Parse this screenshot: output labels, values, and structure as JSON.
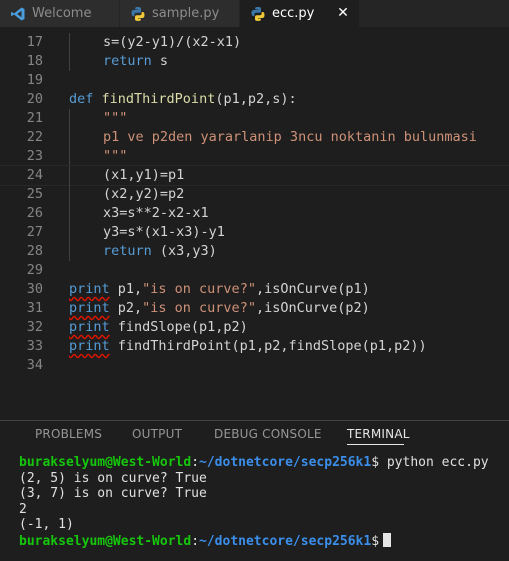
{
  "tabs": [
    {
      "label": "Welcome",
      "icon": "vscode-icon",
      "active": false
    },
    {
      "label": "sample.py",
      "icon": "python-icon",
      "active": false
    },
    {
      "label": "ecc.py",
      "icon": "python-icon",
      "active": true,
      "close": "✕"
    }
  ],
  "editor": {
    "lines": [
      {
        "n": "17",
        "parts": [
          {
            "c": "id",
            "t": "s=(y2-y1)/(x2-x1)"
          }
        ]
      },
      {
        "n": "18",
        "parts": [
          {
            "c": "kw",
            "t": "return"
          },
          {
            "c": "id",
            "t": " s"
          }
        ]
      },
      {
        "n": "19",
        "parts": []
      },
      {
        "n": "20",
        "parts": [
          {
            "c": "kw",
            "t": "def"
          },
          {
            "c": "id",
            "t": " "
          },
          {
            "c": "fn",
            "t": "findThirdPoint"
          },
          {
            "c": "id",
            "t": "(p1,p2,s):"
          }
        ]
      },
      {
        "n": "21",
        "parts": [
          {
            "c": "str",
            "t": "\"\"\""
          }
        ]
      },
      {
        "n": "22",
        "parts": [
          {
            "c": "str",
            "t": "p1 ve p2den yararlanip 3ncu noktanin bulunmasi"
          }
        ]
      },
      {
        "n": "23",
        "parts": [
          {
            "c": "str",
            "t": "\"\"\""
          }
        ]
      },
      {
        "n": "24",
        "parts": [
          {
            "c": "id",
            "t": "(x1,y1)=p1"
          }
        ]
      },
      {
        "n": "25",
        "parts": [
          {
            "c": "id",
            "t": "(x2,y2)=p2"
          }
        ]
      },
      {
        "n": "26",
        "parts": [
          {
            "c": "id",
            "t": "x3=s**2-x2-x1"
          }
        ]
      },
      {
        "n": "27",
        "parts": [
          {
            "c": "id",
            "t": "y3=s*(x1-x3)-y1"
          }
        ]
      },
      {
        "n": "28",
        "parts": [
          {
            "c": "kw",
            "t": "return"
          },
          {
            "c": "id",
            "t": " (x3,y3)"
          }
        ]
      },
      {
        "n": "29",
        "parts": []
      },
      {
        "n": "30",
        "parts": [
          {
            "c": "kw sq",
            "t": "print"
          },
          {
            "c": "id",
            "t": " p1,"
          },
          {
            "c": "str",
            "t": "\"is on curve?\""
          },
          {
            "c": "id",
            "t": ",isOnCurve(p1)"
          }
        ]
      },
      {
        "n": "31",
        "parts": [
          {
            "c": "kw sq",
            "t": "print"
          },
          {
            "c": "id",
            "t": " p2,"
          },
          {
            "c": "str",
            "t": "\"is on curve?\""
          },
          {
            "c": "id",
            "t": ",isOnCurve(p2)"
          }
        ]
      },
      {
        "n": "32",
        "parts": [
          {
            "c": "kw sq",
            "t": "print"
          },
          {
            "c": "id",
            "t": " findSlope(p1,p2)"
          }
        ]
      },
      {
        "n": "33",
        "parts": [
          {
            "c": "kw sq",
            "t": "print"
          },
          {
            "c": "id",
            "t": " findThirdPoint(p1,p2,findSlope(p1,p2))"
          }
        ]
      },
      {
        "n": "34",
        "parts": []
      }
    ]
  },
  "panel": {
    "tabs": [
      "PROBLEMS",
      "OUTPUT",
      "DEBUG CONSOLE",
      "TERMINAL"
    ],
    "active_tab": "TERMINAL"
  },
  "terminal": {
    "prompt_user": "burakselyum@West-World",
    "prompt_sep": ":",
    "prompt_path": "~/dotnetcore/secp256k1",
    "prompt_end": "$",
    "command": " python ecc.py",
    "output": [
      "(2, 5) is on curve? True",
      "(3, 7) is on curve? True",
      "2",
      "(-1, 1)"
    ]
  },
  "colors": {
    "background": "#1e1e1e",
    "keyword": "#569cd6",
    "function": "#dcdcaa",
    "string": "#ce9178",
    "prompt_user": "#16c60c",
    "prompt_path": "#3b8eea"
  }
}
